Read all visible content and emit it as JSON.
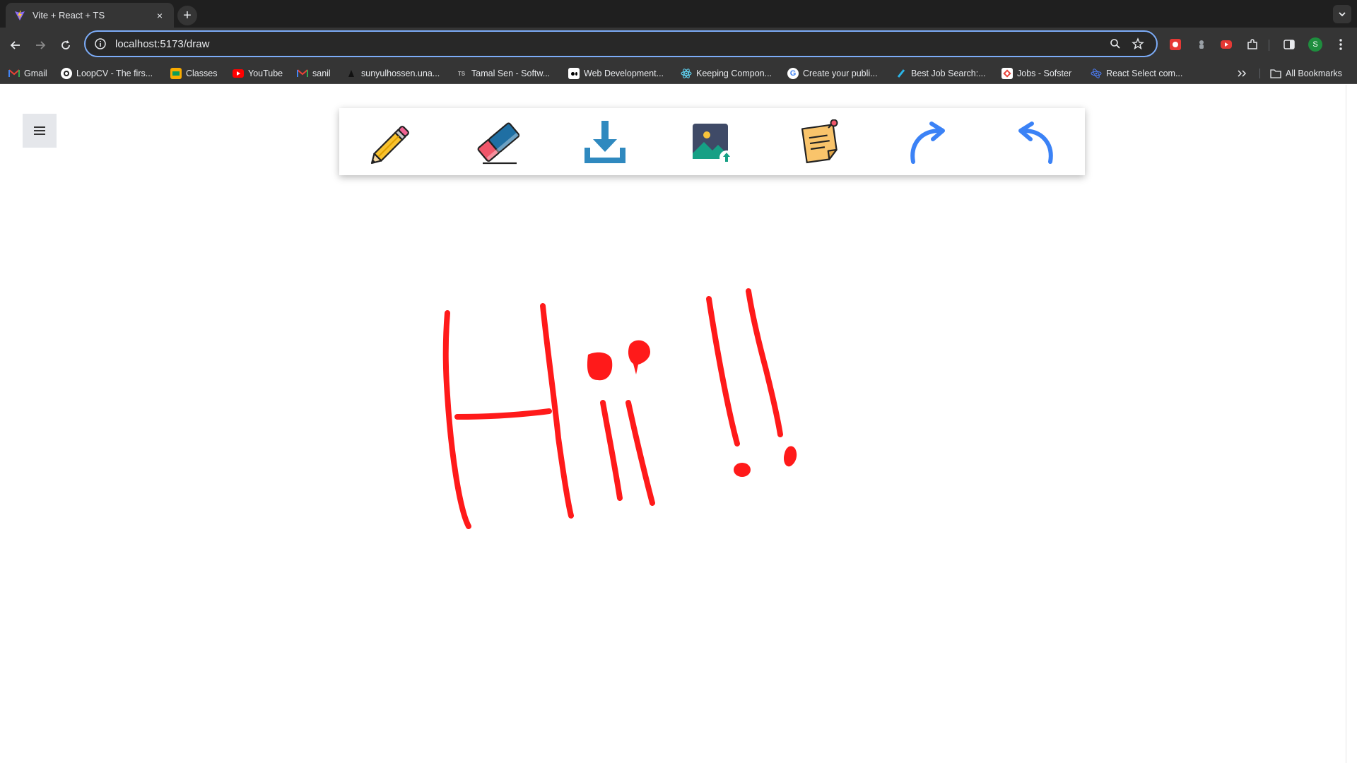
{
  "browser": {
    "tab": {
      "title": "Vite + React + TS",
      "close_glyph": "×"
    },
    "new_tab_glyph": "+",
    "address": {
      "url": "localhost:5173/draw"
    },
    "bookmarks": [
      {
        "label": "Gmail",
        "icon": "gmail-icon"
      },
      {
        "label": "LoopCV - The firs...",
        "icon": "loopcv-icon"
      },
      {
        "label": "Classes",
        "icon": "classroom-icon"
      },
      {
        "label": "YouTube",
        "icon": "youtube-icon"
      },
      {
        "label": "sanil",
        "icon": "gmail-icon"
      },
      {
        "label": "sunyulhossen.una...",
        "icon": "arrow-icon"
      },
      {
        "label": "Tamal Sen - Softw...",
        "icon": "ts-icon"
      },
      {
        "label": "Web Development...",
        "icon": "medium-icon"
      },
      {
        "label": "Keeping Compon...",
        "icon": "react-icon"
      },
      {
        "label": "Create your publi...",
        "icon": "google-icon"
      },
      {
        "label": "Best Job Search:...",
        "icon": "jobsearch-icon"
      },
      {
        "label": "Jobs - Sofster",
        "icon": "sofster-icon"
      },
      {
        "label": "React Select com...",
        "icon": "reactselect-icon"
      }
    ],
    "all_bookmarks_label": "All Bookmarks",
    "profile_initial": "S"
  },
  "app": {
    "tools": [
      {
        "name": "pencil-icon",
        "label": "pencil"
      },
      {
        "name": "eraser-icon",
        "label": "eraser"
      },
      {
        "name": "download-icon",
        "label": "download"
      },
      {
        "name": "image-upload-icon",
        "label": "image upload"
      },
      {
        "name": "sticky-note-icon",
        "label": "sticky note"
      },
      {
        "name": "redo-icon",
        "label": "redo"
      },
      {
        "name": "undo-icon",
        "label": "undo"
      }
    ],
    "canvas": {
      "stroke_color": "#ff1a1a",
      "drawing_text": "Hii!!"
    }
  },
  "colors": {
    "accent": "#7cacf8",
    "stroke": "#ff1a1a",
    "redo_undo": "#3b82f6"
  }
}
